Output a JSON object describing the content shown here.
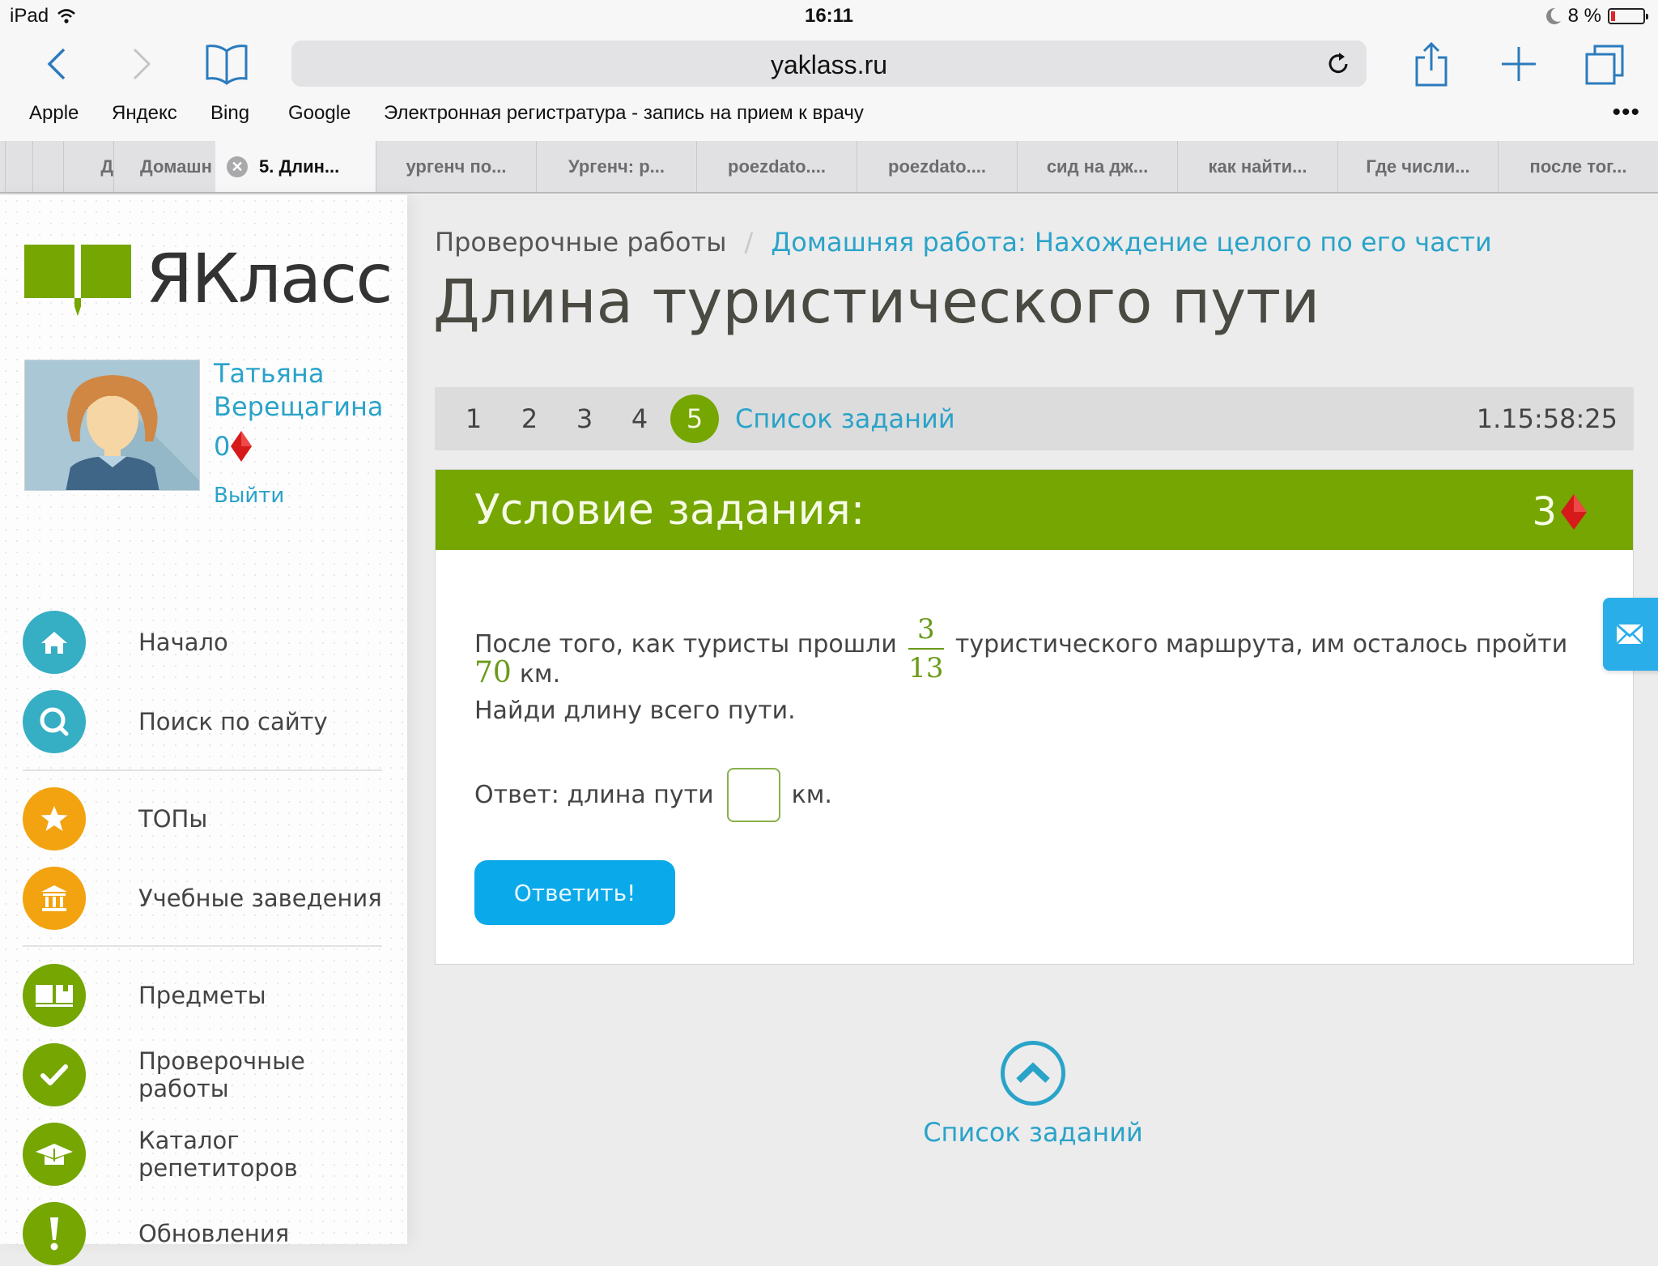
{
  "status_bar": {
    "device": "iPad",
    "time": "16:11",
    "battery": "8 %",
    "battery_level_percent": 8
  },
  "browser": {
    "url": "yaklass.ru",
    "bookmarks": [
      "Apple",
      "Яндекс",
      "Bing",
      "Google",
      "Электронная регистратура - запись на прием к врачу"
    ],
    "more": "•••",
    "tabs": [
      {
        "label": "Д"
      },
      {
        "label": "Домашн"
      },
      {
        "label": "5. Длин...",
        "active": true
      },
      {
        "label": "ургенч по..."
      },
      {
        "label": "Ургенч: р..."
      },
      {
        "label": "poezdato...."
      },
      {
        "label": "poezdato...."
      },
      {
        "label": "сид на дж..."
      },
      {
        "label": "как найти..."
      },
      {
        "label": "Где числи..."
      },
      {
        "label": "после тог..."
      }
    ]
  },
  "sidebar": {
    "logo": "ЯКласс",
    "user": {
      "first_name": "Татьяна",
      "last_name": "Верещагина",
      "points": "0",
      "logout": "Выйти"
    },
    "items": [
      {
        "label": "Начало",
        "icon": "home-icon",
        "color": "#36aec4"
      },
      {
        "label": "Поиск по сайту",
        "icon": "search-icon",
        "color": "#36aec4"
      },
      {
        "label": "ТОПы",
        "icon": "star-icon",
        "color": "#f2a30f"
      },
      {
        "label": "Учебные заведения",
        "icon": "institution-icon",
        "color": "#f2a30f"
      },
      {
        "label": "Предметы",
        "icon": "book-icon",
        "color": "#75a602"
      },
      {
        "label": "Проверочные работы",
        "icon": "checkmark-icon",
        "color": "#75a602"
      },
      {
        "label": "Каталог репетиторов",
        "icon": "graduation-cap-icon",
        "color": "#75a602"
      },
      {
        "label": "Обновления",
        "icon": "exclamation-icon",
        "color": "#75a602"
      }
    ]
  },
  "main": {
    "breadcrumb": {
      "parent": "Проверочные работы",
      "separator": "/",
      "current": "Домашняя работа: Нахождение целого по его части"
    },
    "title": "Длина туристического пути",
    "task_nav": {
      "numbers": [
        "1",
        "2",
        "3",
        "4",
        "5"
      ],
      "active": "5",
      "list_link": "Список заданий",
      "timer": "1.15:58:25"
    },
    "task": {
      "header": "Условие задания:",
      "score": "3",
      "text_before_fraction": "После того, как туристы прошли",
      "fraction_numerator": "3",
      "fraction_denominator": "13",
      "text_after_fraction": "туристического маршрута, им осталось пройти",
      "distance_value": "70",
      "distance_unit": "км.",
      "question": "Найди длину всего пути.",
      "answer_label": "Ответ: длина пути",
      "answer_value": "",
      "answer_unit": "км.",
      "submit": "Ответить!"
    },
    "bottom_link": "Список заданий"
  },
  "colors": {
    "brand_green": "#75a602",
    "link_blue": "#2aa3c9",
    "button_blue": "#0aa9ea",
    "diamond_red": "#d61a1a"
  }
}
